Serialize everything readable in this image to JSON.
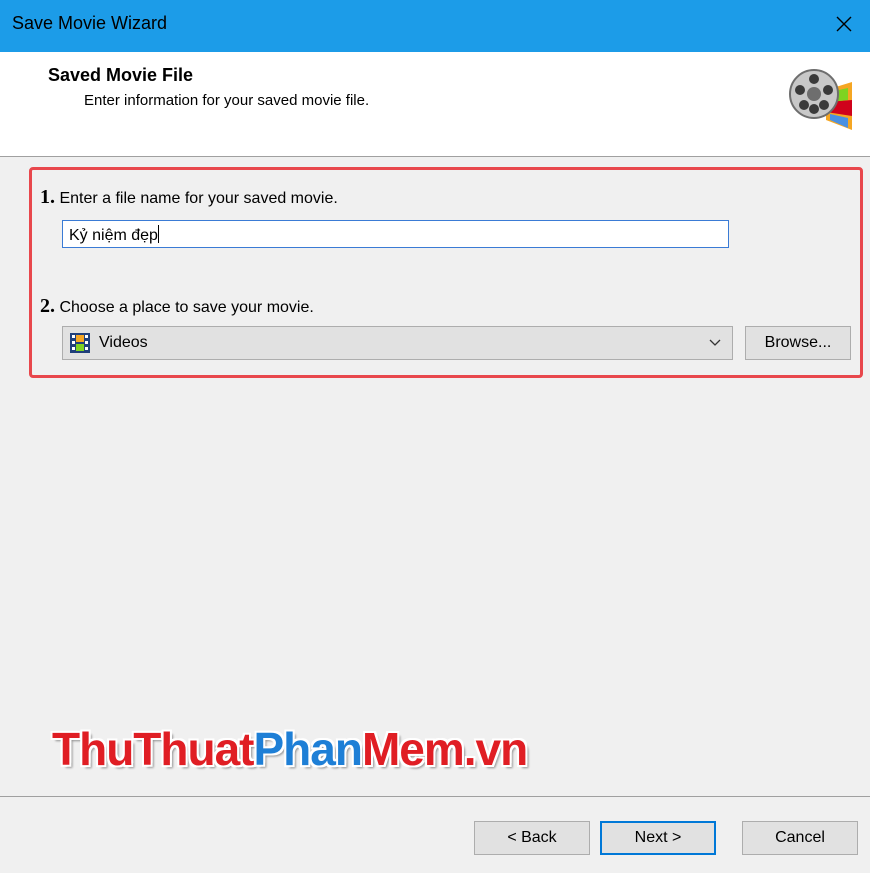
{
  "window": {
    "title": "Save Movie Wizard",
    "close_icon": "close-icon"
  },
  "header": {
    "title": "Saved Movie File",
    "subtitle": "Enter information for your saved movie file.",
    "logo_icon": "film-reel-icon"
  },
  "steps": {
    "step1_number": "1.",
    "step1_label": "Enter a file name for your saved movie.",
    "file_name_value": "Kỷ niệm đẹp",
    "step2_number": "2.",
    "step2_label": "Choose a place to save your movie.",
    "location_value": "Videos",
    "location_icon": "video-folder-icon",
    "browse_label": "Browse..."
  },
  "watermark": {
    "part1": "ThuThuat",
    "part2": "Phan",
    "part3": "Mem.vn"
  },
  "footer": {
    "back_label": "< Back",
    "next_label": "Next >",
    "cancel_label": "Cancel"
  },
  "colors": {
    "titlebar": "#1c9ce8",
    "highlight": "#e8474c",
    "focus": "#0078d7"
  }
}
